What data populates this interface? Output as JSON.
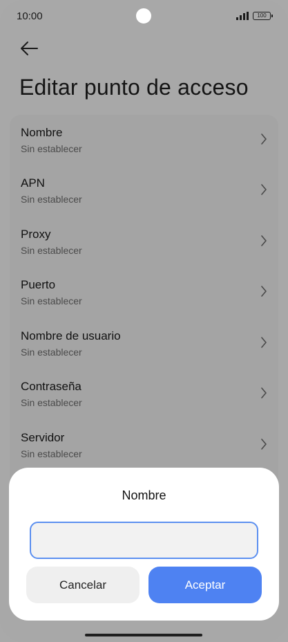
{
  "status_bar": {
    "time": "10:00",
    "battery": "100",
    "signal_icon": "signal-icon"
  },
  "header": {
    "back_icon": "arrow-left-icon",
    "title": "Editar punto de acceso"
  },
  "settings": {
    "items": [
      {
        "label": "Nombre",
        "value": "Sin establecer"
      },
      {
        "label": "APN",
        "value": "Sin establecer"
      },
      {
        "label": "Proxy",
        "value": "Sin establecer"
      },
      {
        "label": "Puerto",
        "value": "Sin establecer"
      },
      {
        "label": "Nombre de usuario",
        "value": "Sin establecer"
      },
      {
        "label": "Contraseña",
        "value": "Sin establecer"
      },
      {
        "label": "Servidor",
        "value": "Sin establecer"
      }
    ]
  },
  "dialog": {
    "title": "Nombre",
    "input_value": "",
    "cancel_label": "Cancelar",
    "accept_label": "Aceptar"
  },
  "colors": {
    "accent": "#4e82f2",
    "input_border": "#5b8ff0",
    "scrim": "#a8a8a8"
  }
}
